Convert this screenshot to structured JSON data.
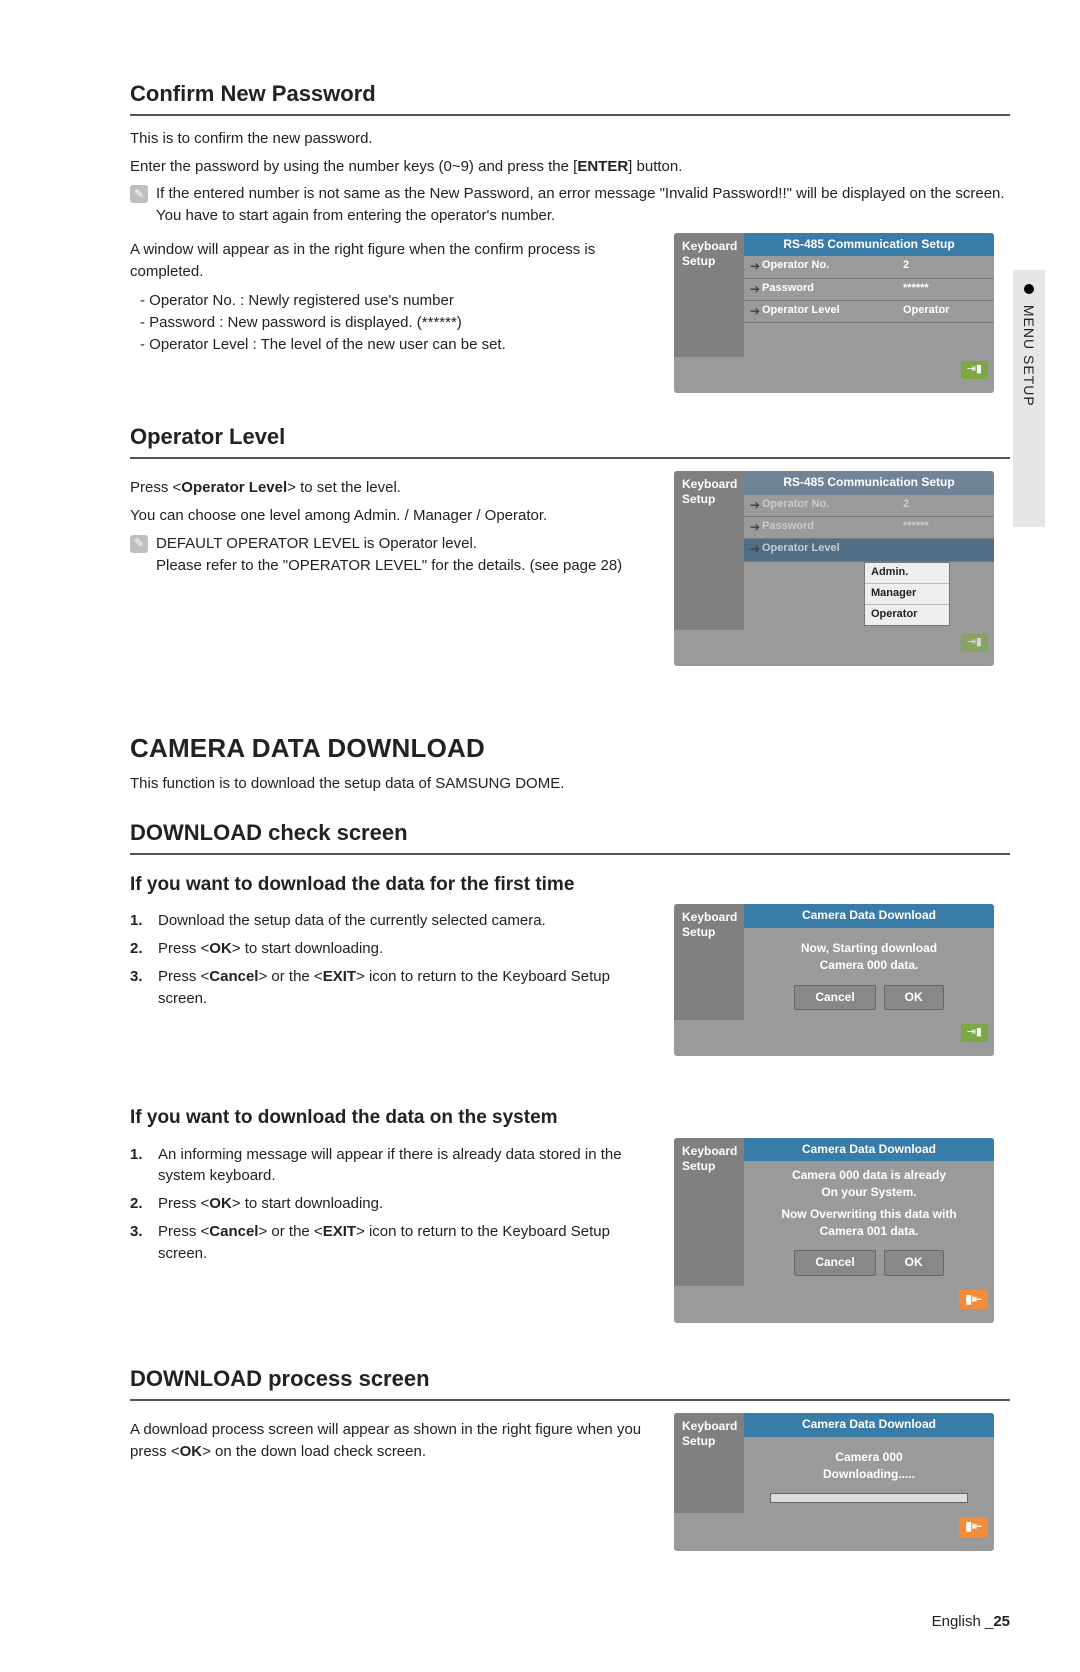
{
  "side_tab": "MENU SETUP",
  "s1": {
    "title": "Confirm New Password",
    "p1": "This is to confirm the new password.",
    "p2_a": "Enter the password by using the number keys (0~9) and press the [",
    "p2_b": "ENTER",
    "p2_c": "] button.",
    "note": "If the entered number is not same as the New Password, an error message \"Invalid Password!!\" will be displayed on the screen. You have to start again from entering the operator's number.",
    "p3": "A window will appear as in the right figure when the confirm process is completed.",
    "bullets": [
      "Operator No. : Newly registered use's number",
      "Password : New password is displayed. (******)",
      "Operator Level : The level of the new user can be set."
    ]
  },
  "panel_rs485": {
    "side": "Keyboard\nSetup",
    "title": "RS-485 Communication Setup",
    "rows": [
      {
        "label": "Operator No.",
        "value": "2"
      },
      {
        "label": "Password",
        "value": "******"
      },
      {
        "label": "Operator Level",
        "value": "Operator"
      }
    ]
  },
  "s2": {
    "title": "Operator Level",
    "p1_a": "Press <",
    "p1_b": "Operator Level",
    "p1_c": "> to set the level.",
    "p2": "You can choose one level among Admin. / Manager / Operator.",
    "note_a": "DEFAULT OPERATOR LEVEL is Operator level.",
    "note_b": "Please refer to the \"OPERATOR LEVEL\" for the details. (see page 28)"
  },
  "panel_level": {
    "side": "Keyboard\nSetup",
    "title": "RS-485 Communication Setup",
    "rows": [
      {
        "label": "Operator No.",
        "value": "2"
      },
      {
        "label": "Password",
        "value": "******"
      },
      {
        "label": "Operator Level",
        "value": ""
      }
    ],
    "dropdown": [
      "Admin.",
      "Manager",
      "Operator"
    ]
  },
  "s3": {
    "big_title": "CAMERA DATA DOWNLOAD",
    "p1": "This function is to download the setup data of SAMSUNG DOME."
  },
  "s4": {
    "title": "DOWNLOAD check screen",
    "sub1": "If you want to download the data for the first time",
    "steps1": [
      "Download the setup data of the currently selected camera.",
      "Press <OK> to start downloading.",
      "Press <Cancel> or the <EXIT> icon to return to the Keyboard Setup screen."
    ],
    "sub2": "If you want to download the data on the system",
    "steps2": [
      "An informing message will appear if there is already data stored in the system keyboard.",
      "Press <OK> to start downloading.",
      "Press <Cancel> or the <EXIT> icon to return to the Keyboard Setup screen."
    ]
  },
  "panel_dl1": {
    "side": "Keyboard\nSetup",
    "title": "Camera Data Download",
    "msg": "Now, Starting download\nCamera 000 data.",
    "cancel": "Cancel",
    "ok": "OK"
  },
  "panel_dl2": {
    "side": "Keyboard\nSetup",
    "title": "Camera Data Download",
    "msg1": "Camera 000 data is already\nOn your System.",
    "msg2": "Now Overwriting this data with\nCamera 001 data.",
    "cancel": "Cancel",
    "ok": "OK"
  },
  "s5": {
    "title": "DOWNLOAD process screen",
    "p1_a": "A download process screen will appear as shown in the right figure when you press <",
    "p1_b": "OK",
    "p1_c": "> on the down load check screen."
  },
  "panel_dl3": {
    "side": "Keyboard\nSetup",
    "title": "Camera Data Download",
    "msg": "Camera 000\nDownloading....."
  },
  "footer": {
    "lang": "English",
    "sep": " _",
    "page": "25"
  }
}
